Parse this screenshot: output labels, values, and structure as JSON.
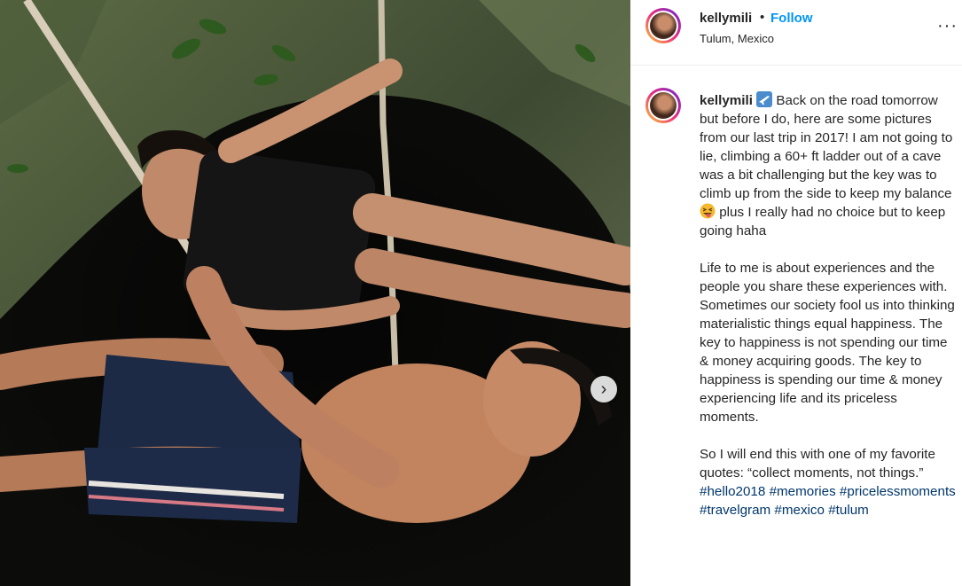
{
  "post": {
    "next_icon": "chevron-right-icon"
  },
  "header": {
    "username": "kellymili",
    "separator": "•",
    "follow_label": "Follow",
    "location": "Tulum, Mexico",
    "more_icon": "ellipsis-icon",
    "more_label": "···"
  },
  "caption": {
    "username": "kellymili",
    "emoji_plane": "airplane-emoji",
    "p1": "Back on the road tomorrow but before I do, here are some pictures from our last trip in 2017! I am not going to lie, climbing a 60+ ft ladder out of a cave was a bit challenging but the key was to climb up from the side to keep my balance",
    "emoji_face": "squinting-face-with-tongue-emoji",
    "p1_end": "plus I really had no choice but to keep going haha",
    "p2": "Life to me is about experiences and the people you share these experiences with. Sometimes our society fool us into thinking materialistic things equal happiness. The key to happiness is not spending our time & money acquiring goods. The key to happiness is spending our time & money experiencing life and its priceless moments.",
    "p3": "So I will end this with one of my favorite quotes: “collect moments, not things.”",
    "hashtags": [
      "#hello2018",
      "#memories",
      "#pricelessmoments",
      "#travelgram",
      "#mexico",
      "#tulum"
    ]
  }
}
